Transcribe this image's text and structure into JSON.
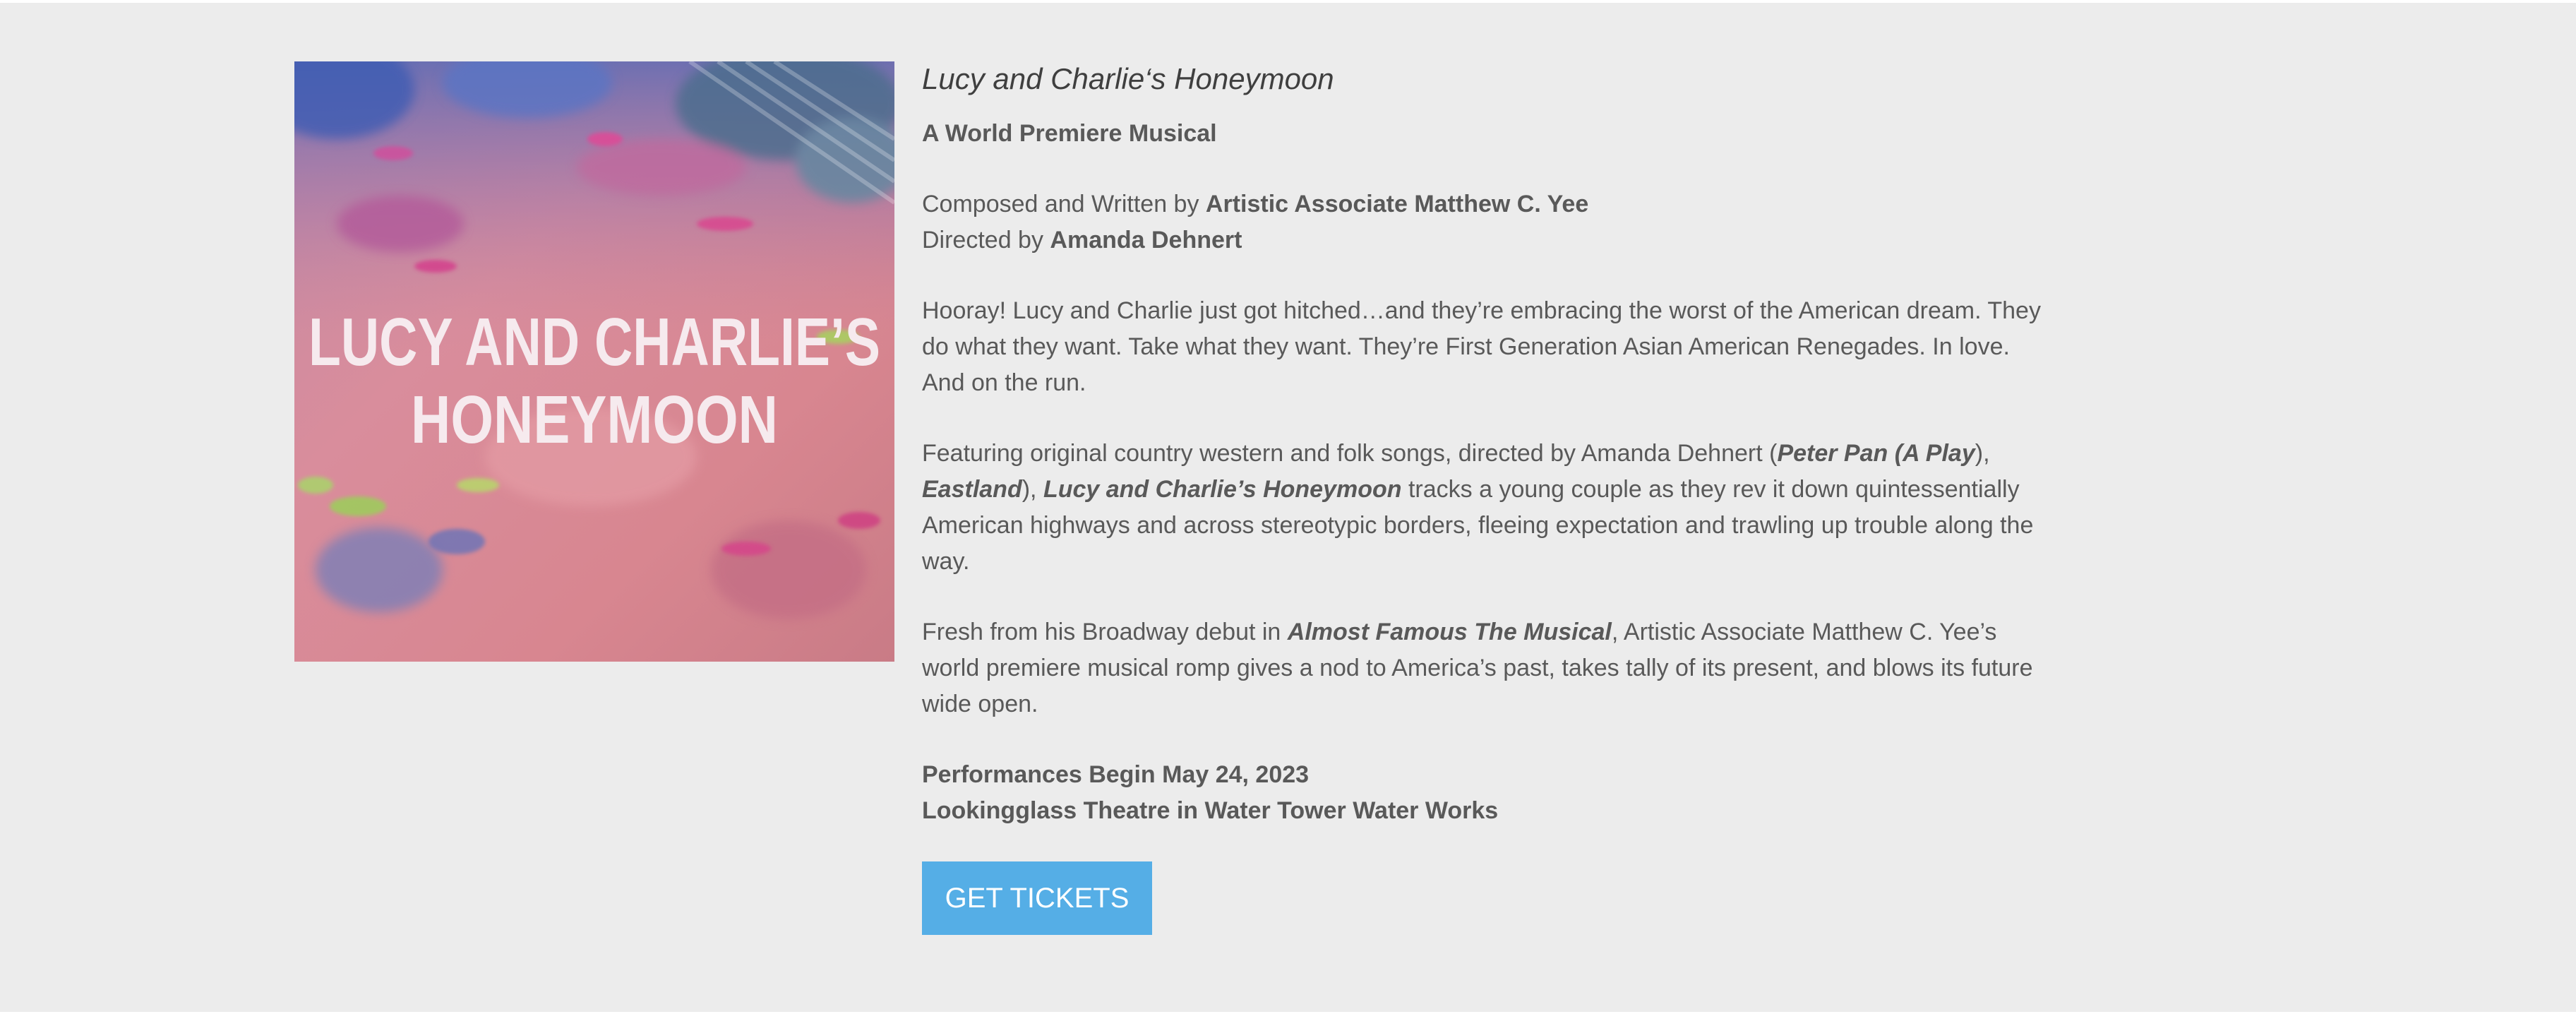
{
  "show": {
    "title": "Lucy and Charlie‘s Honeymoon",
    "subtitle": "A World Premiere Musical"
  },
  "poster": {
    "line1": "LUCY AND CHARLIE’S",
    "line2": "HONEYMOON"
  },
  "credits": {
    "composed_prefix": "Composed and Written by ",
    "composer": "Artistic Associate Matthew C. Yee",
    "directed_prefix": "Directed by ",
    "director": "Amanda Dehnert"
  },
  "paragraphs": {
    "p1": "Hooray! Lucy and Charlie just got hitched…and they’re embracing the worst of the American dream. They do what they want. Take what they want. They’re First Generation Asian American Renegades. In love. And on the run.",
    "p2": {
      "a": "Featuring original country western and folk songs, directed by Amanda Dehnert (",
      "b": "Peter Pan (A Play",
      "c": "), ",
      "d": "Eastland",
      "e": "), ",
      "f": "Lucy and Charlie’s Honeymoon",
      "g": " tracks a young couple as they rev it down quintessentially American highways and across stereotypic borders, fleeing expectation and trawling up trouble along the way."
    },
    "p3": {
      "a": "Fresh from his Broadway debut in ",
      "b": "Almost Famous The Musical",
      "c": ", Artistic Associate Matthew C. Yee’s world premiere musical romp gives a nod to America’s past, takes tally of its present, and blows its future wide open."
    }
  },
  "details": {
    "dates": "Performances Begin May 24, 2023",
    "venue": "Lookingglass Theatre in Water Tower Water Works"
  },
  "cta": {
    "label": "GET TICKETS",
    "color": "#55aee6"
  },
  "colors": {
    "background": "#ececec",
    "text": "#595959"
  }
}
